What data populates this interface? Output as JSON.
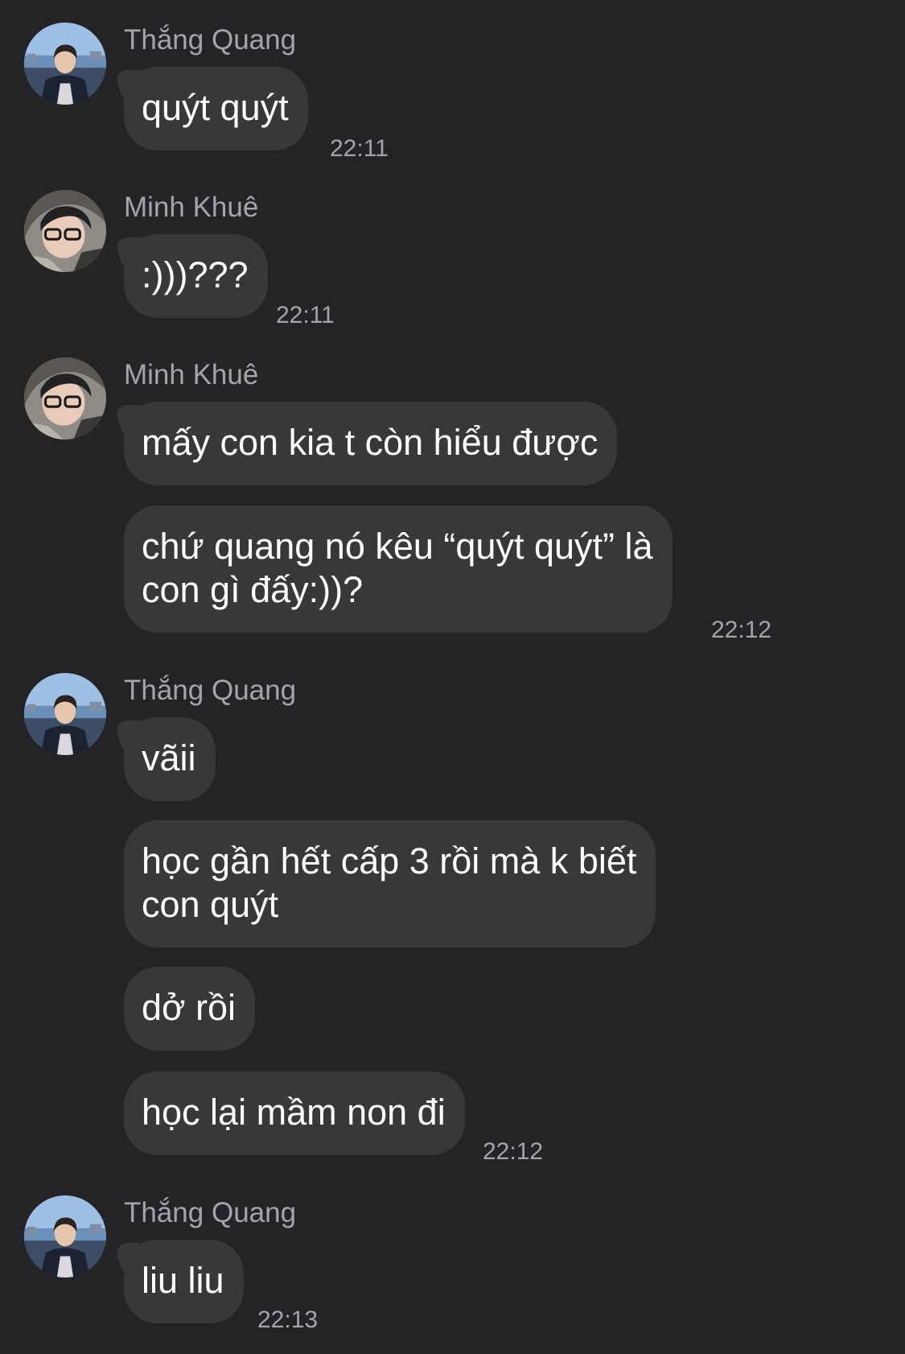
{
  "avatars": {
    "thang": "avatar-thang-quang",
    "minh": "avatar-minh-khue"
  },
  "groups": [
    {
      "sender": "Thắng Quang",
      "avatar": "thang",
      "messages": [
        "quýt quýt"
      ],
      "time": "22:11"
    },
    {
      "sender": "Minh Khuê",
      "avatar": "minh",
      "messages": [
        ":)))???"
      ],
      "time": "22:11"
    },
    {
      "sender": "Minh Khuê",
      "avatar": "minh",
      "messages": [
        "mấy con kia t còn hiểu được",
        "chứ quang nó kêu “quýt quýt” là\ncon gì đấy:))?"
      ],
      "time": "22:12"
    },
    {
      "sender": "Thắng Quang",
      "avatar": "thang",
      "messages": [
        "vãii",
        "học gần hết cấp 3 rồi mà k biết\ncon quýt",
        "dở rồi",
        "học lại mầm non đi"
      ],
      "time": "22:12"
    },
    {
      "sender": "Thắng Quang",
      "avatar": "thang",
      "messages": [
        "liu liu"
      ],
      "time": "22:13"
    }
  ],
  "colors": {
    "background": "#242426",
    "bubble": "#38383b",
    "text": "#ffffff",
    "meta": "#a5a5a9"
  }
}
